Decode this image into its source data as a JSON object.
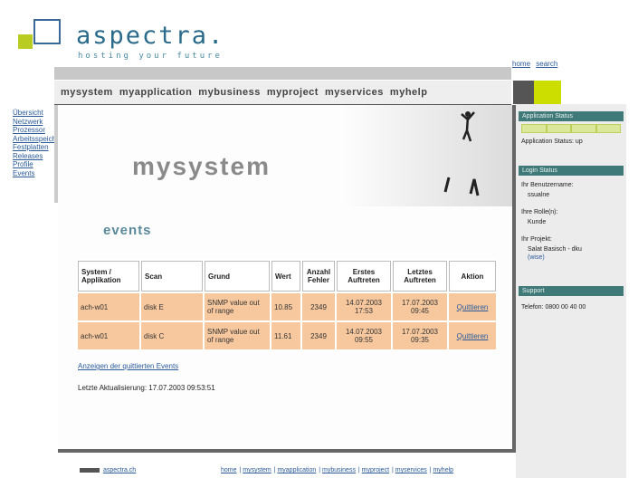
{
  "brand": {
    "name": "aspectra.",
    "tagline": "hosting your future"
  },
  "header": {
    "links": [
      "home",
      "search"
    ]
  },
  "nav": {
    "items": [
      "mysystem",
      "myapplication",
      "mybusiness",
      "myproject",
      "myservices",
      "myhelp"
    ]
  },
  "sidebar": {
    "items": [
      "Übersicht",
      "Netzwerk",
      "Prozessor",
      "Arbeitsspeicher",
      "Festplatten",
      "Releases",
      "Profile",
      "Events"
    ]
  },
  "main": {
    "title": "mysystem",
    "section_heading": "events",
    "table": {
      "headers": [
        "System / Applikation",
        "Scan",
        "Grund",
        "Wert",
        "Anzahl Fehler",
        "Erstes Auftreten",
        "Letztes Auftreten",
        "Aktion"
      ],
      "rows": [
        [
          "ach-w01",
          "disk E",
          "SNMP value out of range",
          "10.85",
          "2349",
          "14.07.2003 17:53",
          "17.07.2003 09:45",
          "Quittieren"
        ],
        [
          "ach-w01",
          "disk C",
          "SNMP value out of range",
          "11.61",
          "2349",
          "14.07.2003 09:55",
          "17.07.2003 09:35",
          "Quittieren"
        ]
      ]
    },
    "list_link": "Anzeigen der quittierten Events",
    "last_update": "Letzte Aktualisierung: 17.07.2003 09:53:51"
  },
  "right_panel": {
    "status": {
      "title": "Application Status",
      "text": "Application Status: up"
    },
    "login": {
      "title": "Login Status",
      "user_label": "Ihr Benutzername:",
      "user_value": "ssualne",
      "role_label": "Ihre Rolle(n):",
      "role_value": "Kunde",
      "project_label": "Ihr Projekt:",
      "project_value": "Salat Basisch - dku",
      "project_link": "(wise)"
    },
    "support": {
      "title": "Support",
      "text": "Telefon: 0800 00 40 00"
    }
  },
  "footer": {
    "left": "aspectra.ch",
    "links": [
      "home",
      "mysystem",
      "myapplication",
      "mybusiness",
      "myproject",
      "myservices",
      "myhelp"
    ]
  },
  "colors": {
    "accent_teal": "#3f7a78",
    "lime": "#ccdd00",
    "table_row": "#f7c89e"
  }
}
